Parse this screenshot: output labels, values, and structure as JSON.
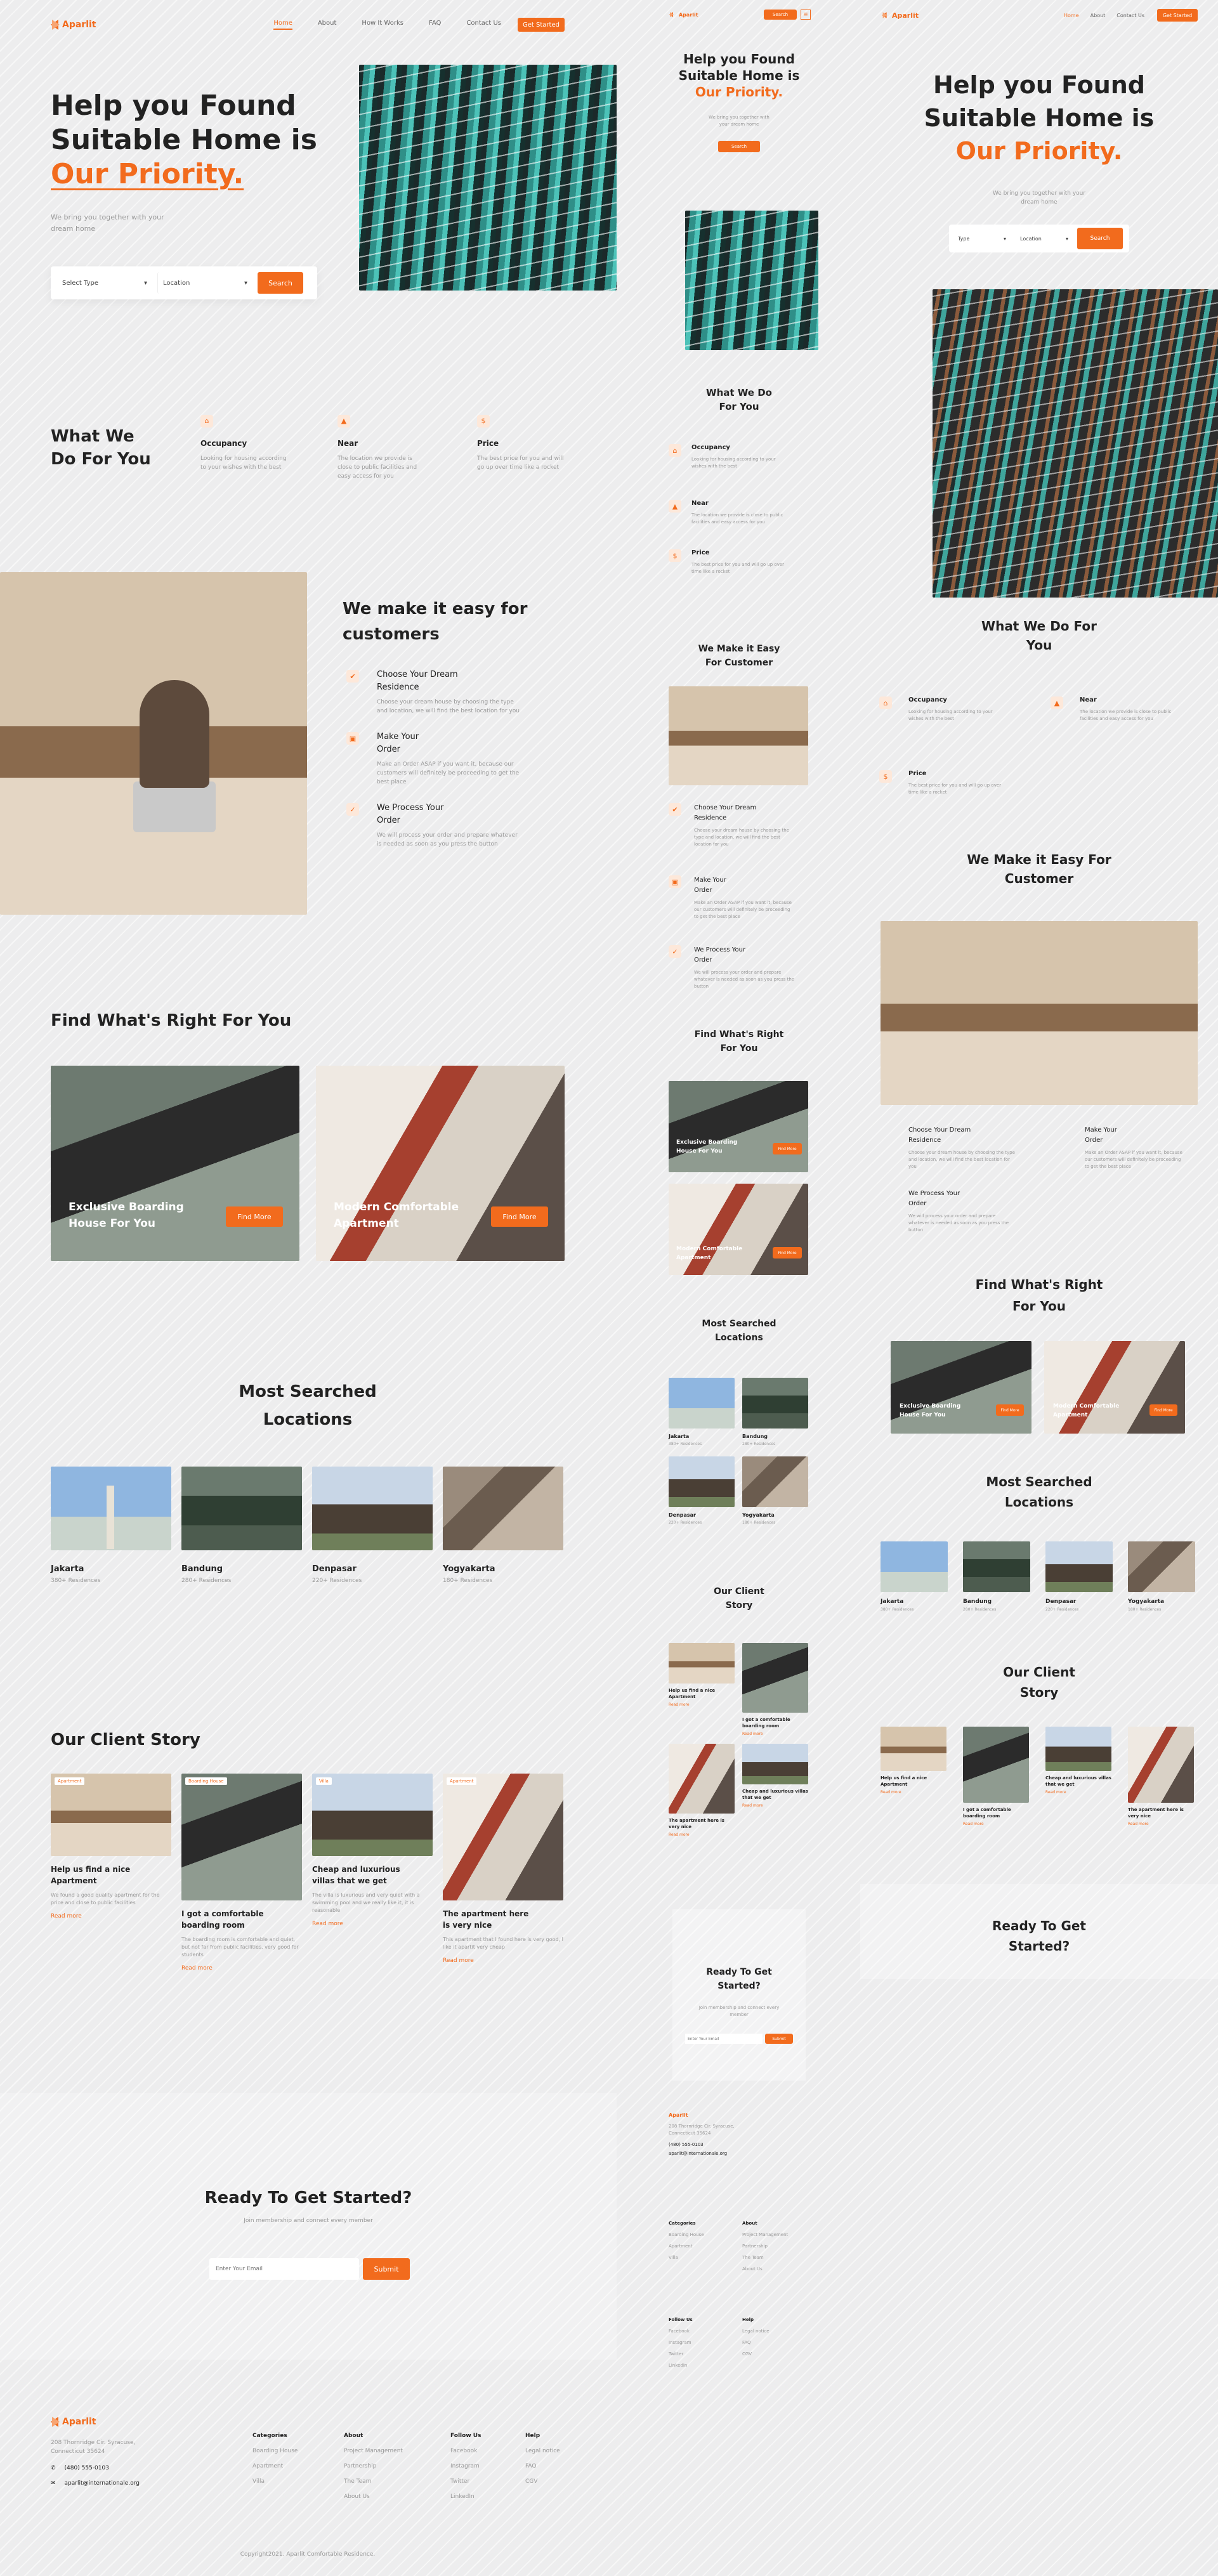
{
  "brand": {
    "name": "Aparlit"
  },
  "nav": {
    "items": [
      "Home",
      "About",
      "How It Works",
      "FAQ",
      "Contact Us"
    ],
    "cta": "Get Started",
    "tablet_cta": "Search"
  },
  "hero": {
    "title_line1": "Help you Found",
    "title_line2": "Suitable Home is",
    "title_highlight": "Our Priority.",
    "subtitle": "We bring you together with your dream home",
    "select_type": "Select Type",
    "select_location": "Location",
    "search_label": "Search",
    "type_short": "Type"
  },
  "services": {
    "title": "What We Do For You",
    "items": [
      {
        "title": "Occupancy",
        "desc": "Looking for housing according to your wishes with the best"
      },
      {
        "title": "Near",
        "desc": "The location we provide is close to public facilities and easy access for you"
      },
      {
        "title": "Price",
        "desc": "The best price for you and will go up over time like a rocket"
      }
    ]
  },
  "easy": {
    "title": "We make it easy for customers",
    "title_alt": "We Make it Easy For Customer",
    "items": [
      {
        "title": "Choose Your Dream Residence",
        "desc": "Choose your dream house by choosing the type and location, we will find the best location for you"
      },
      {
        "title": "Make Your Order",
        "desc": "Make an Order ASAP if you want it, because our customers will definitely be proceeding to get the best place"
      },
      {
        "title": "We Process Your Order",
        "desc": "We will process your order and prepare whatever is needed as soon as you press the button"
      }
    ]
  },
  "right": {
    "title": "Find What's Right For You",
    "cards": [
      {
        "title": "Exclusive Boarding House For You",
        "button": "Find More"
      },
      {
        "title": "Modern Comfortable Apartment",
        "button": "Find More"
      }
    ]
  },
  "locations": {
    "title": "Most Searched Locations",
    "items": [
      {
        "name": "Jakarta",
        "count": "380+ Residences"
      },
      {
        "name": "Bandung",
        "count": "280+ Residences"
      },
      {
        "name": "Denpasar",
        "count": "220+ Residences"
      },
      {
        "name": "Yogyakarta",
        "count": "180+ Residences"
      }
    ]
  },
  "stories": {
    "title": "Our Client Story",
    "items": [
      {
        "tag": "Apartment",
        "title": "Help us find a nice Apartment",
        "desc": "We found a good quality apartment for the price and close to public facilities",
        "link": "Read more"
      },
      {
        "tag": "Boarding House",
        "title": "I got a comfortable boarding room",
        "desc": "The boarding room is comfortable and quiet, but not far from public facilities, very good for students",
        "link": "Read more"
      },
      {
        "tag": "Villa",
        "title": "Cheap and luxurious villas that we get",
        "desc": "The villa is luxurious and very quiet with a swimming pool and we really like it, it is reasonable",
        "link": "Read more"
      },
      {
        "tag": "Apartment",
        "title": "The apartment here is very nice",
        "desc": "This apartment that I found here is very good, I like it apartit very cheap",
        "link": "Read more"
      }
    ]
  },
  "cta": {
    "title": "Ready To Get Started?",
    "subtitle": "Join membership and connect every member",
    "placeholder": "Enter Your Email",
    "button": "Submit"
  },
  "footer": {
    "address": "208 Thornridge Cir. Syracuse, Connecticut 35624",
    "phone": "(480) 555-0103",
    "email": "aparlit@internationale.org",
    "columns": [
      {
        "title": "Categories",
        "links": [
          "Boarding House",
          "Apartment",
          "Villa"
        ]
      },
      {
        "title": "About",
        "links": [
          "Project Management",
          "Partnership",
          "The Team",
          "About Us"
        ]
      },
      {
        "title": "Follow Us",
        "links": [
          "Facebook",
          "Instagram",
          "Twitter",
          "LinkedIn"
        ]
      },
      {
        "title": "Help",
        "links": [
          "Legal notice",
          "FAQ",
          "CGV"
        ]
      }
    ],
    "copyright": "Copyright2021. Aparlit Comfortable Residence."
  },
  "colors": {
    "accent": "#f26b1d",
    "text": "#222222",
    "muted": "#9a9a9a"
  }
}
